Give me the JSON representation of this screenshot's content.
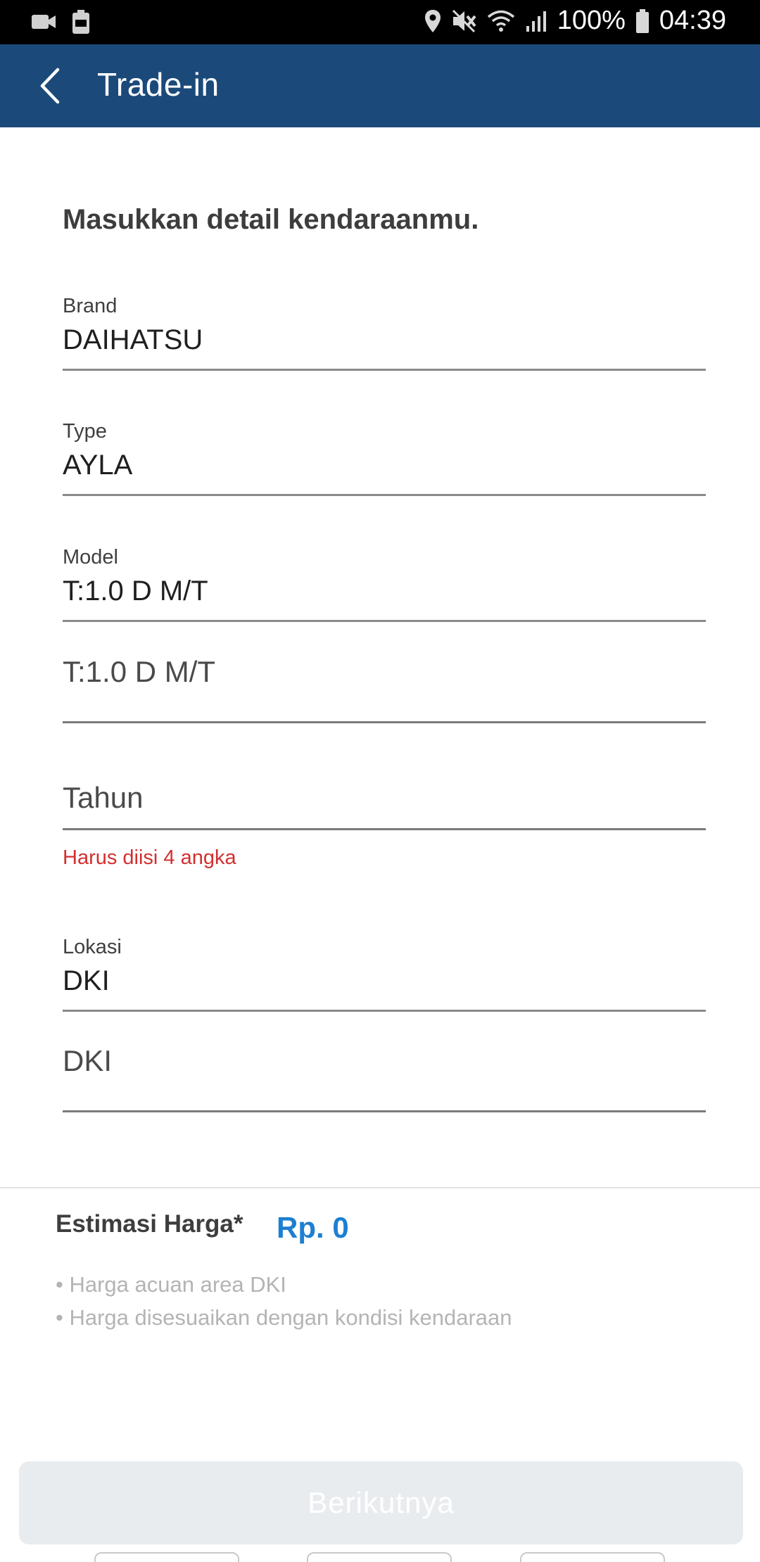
{
  "status_bar": {
    "battery_percent": "100%",
    "time": "04:39",
    "left_icons": [
      "video-icon",
      "battery-saver-icon"
    ],
    "right_icons": [
      "location-icon",
      "mute-icon",
      "wifi-icon",
      "signal-icon",
      "battery-icon"
    ]
  },
  "app_bar": {
    "title": "Trade-in",
    "background": "#1b4a7a"
  },
  "form": {
    "heading": "Masukkan detail kendaraanmu.",
    "brand": {
      "label": "Brand",
      "value": "DAIHATSU"
    },
    "type": {
      "label": "Type",
      "value": "AYLA"
    },
    "model": {
      "label": "Model",
      "value": "T:1.0 D M/T",
      "input_value": "T:1.0 D M/T"
    },
    "year": {
      "placeholder": "Tahun",
      "error": "Harus diisi 4 angka"
    },
    "location": {
      "label": "Lokasi",
      "value": "DKI",
      "input_value": "DKI"
    }
  },
  "estimate": {
    "label": "Estimasi Harga*",
    "value": "Rp. 0",
    "notes": [
      "• Harga acuan area DKI",
      "• Harga disesuaikan dengan kondisi kendaraan"
    ]
  },
  "actions": {
    "next_label": "Berikutnya"
  },
  "colors": {
    "accent": "#1e7fd1",
    "error": "#d32f2f",
    "disabled_button": "#e9ecef"
  }
}
